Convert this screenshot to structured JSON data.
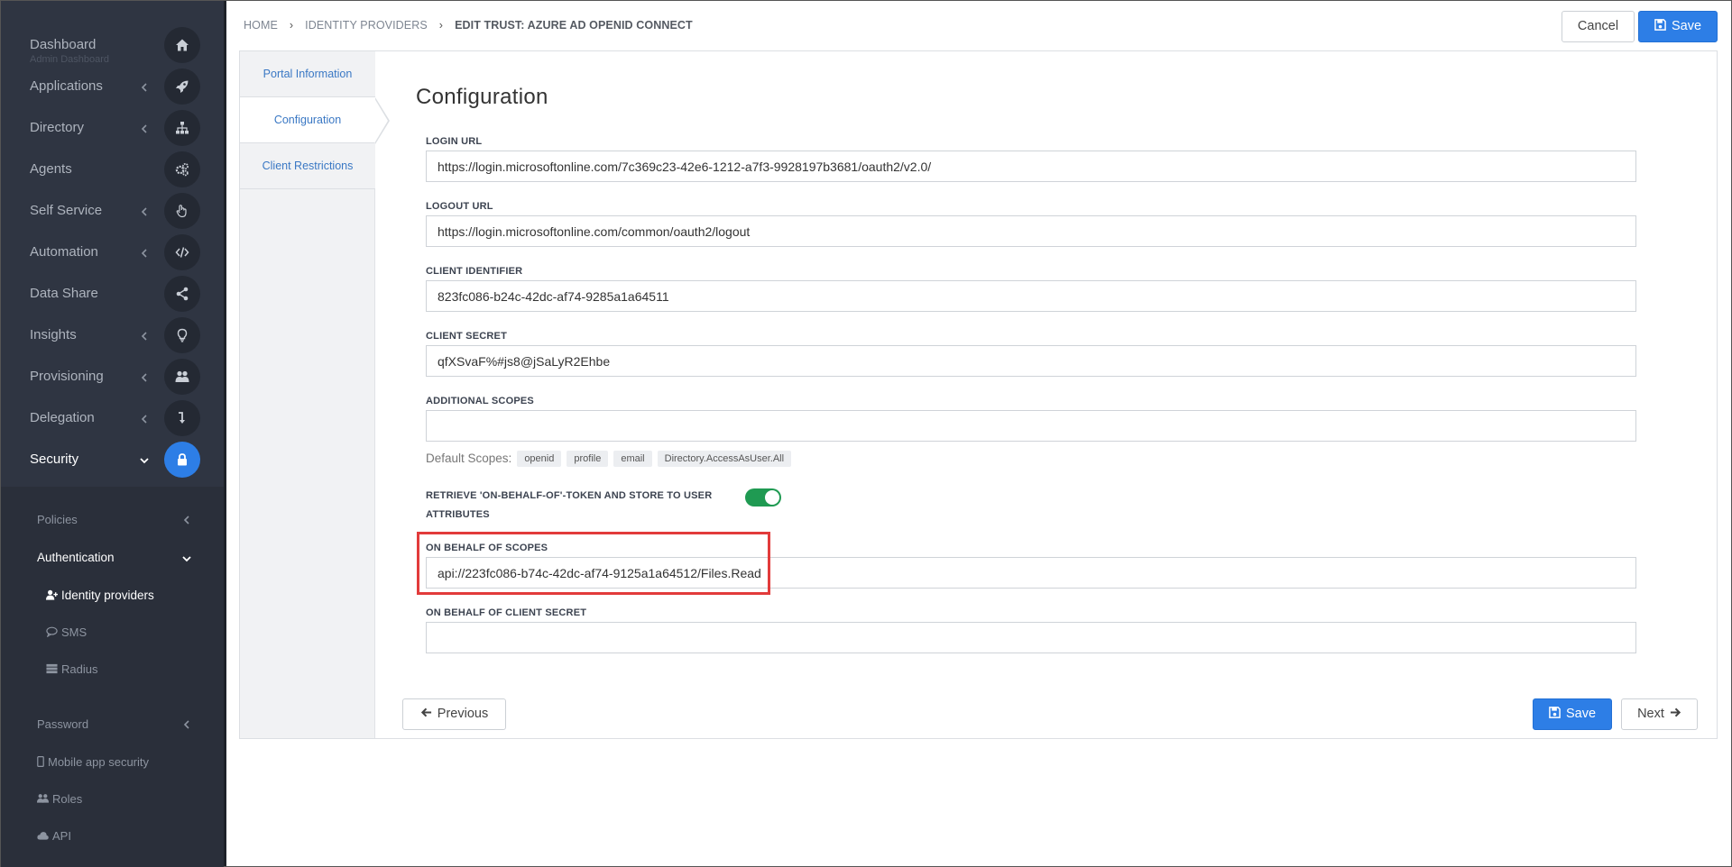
{
  "sidebar": {
    "items": [
      {
        "label": "Dashboard",
        "sub": "Admin Dashboard",
        "icon": "home-icon",
        "chevron": false,
        "active": false
      },
      {
        "label": "Applications",
        "icon": "rocket-icon",
        "chevron": true,
        "active": false
      },
      {
        "label": "Directory",
        "icon": "sitemap-icon",
        "chevron": true,
        "active": false
      },
      {
        "label": "Agents",
        "icon": "gears-icon",
        "chevron": false,
        "active": false
      },
      {
        "label": "Self Service",
        "icon": "hand-icon",
        "chevron": true,
        "active": false
      },
      {
        "label": "Automation",
        "icon": "code-icon",
        "chevron": true,
        "active": false
      },
      {
        "label": "Data Share",
        "icon": "share-icon",
        "chevron": false,
        "active": false
      },
      {
        "label": "Insights",
        "icon": "lightbulb-icon",
        "chevron": true,
        "active": false
      },
      {
        "label": "Provisioning",
        "icon": "users-icon",
        "chevron": true,
        "active": false
      },
      {
        "label": "Delegation",
        "icon": "level-down-icon",
        "chevron": true,
        "active": false
      },
      {
        "label": "Security",
        "icon": "lock-icon",
        "chevron": true,
        "active": true
      }
    ],
    "security_menu": {
      "policies": "Policies",
      "authentication": "Authentication",
      "identity_providers": "Identity providers",
      "sms": "SMS",
      "radius": "Radius",
      "password": "Password",
      "mobile_app_security": "Mobile app security",
      "roles": "Roles",
      "api": "API"
    }
  },
  "breadcrumb": {
    "home": "HOME",
    "identity_providers": "IDENTITY PROVIDERS",
    "current": "EDIT TRUST: AZURE AD OPENID CONNECT"
  },
  "toolbar": {
    "cancel_label": "Cancel",
    "save_label": "Save"
  },
  "tabs": [
    {
      "label": "Portal Information",
      "active": false
    },
    {
      "label": "Configuration",
      "active": true
    },
    {
      "label": "Client Restrictions",
      "active": false
    }
  ],
  "form": {
    "title": "Configuration",
    "login_url": {
      "label": "LOGIN URL",
      "value": "https://login.microsoftonline.com/7c369c23-42e6-1212-a7f3-9928197b3681/oauth2/v2.0/"
    },
    "logout_url": {
      "label": "LOGOUT URL",
      "value": "https://login.microsoftonline.com/common/oauth2/logout"
    },
    "client_identifier": {
      "label": "CLIENT IDENTIFIER",
      "value": "823fc086-b24c-42dc-af74-9285a1a64511"
    },
    "client_secret": {
      "label": "CLIENT SECRET",
      "value": "qfXSvaF%#js8@jSaLyR2Ehbe"
    },
    "additional_scopes": {
      "label": "ADDITIONAL SCOPES",
      "value": ""
    },
    "default_scopes": {
      "label": "Default Scopes:",
      "tags": [
        "openid",
        "profile",
        "email",
        "Directory.AccessAsUser.All"
      ]
    },
    "obo_toggle": {
      "label_line1": "RETRIEVE 'ON-BEHALF-OF'-TOKEN AND STORE TO USER",
      "label_line2": "ATTRIBUTES",
      "on": true
    },
    "obo_scopes": {
      "label": "ON BEHALF OF SCOPES",
      "value": "api://223fc086-b74c-42dc-af74-9125a1a64512/Files.Read"
    },
    "obo_client_secret": {
      "label": "ON BEHALF OF CLIENT SECRET",
      "value": ""
    }
  },
  "footer": {
    "previous_label": "Previous",
    "save_label": "Save",
    "next_label": "Next"
  },
  "colors": {
    "sidebar_bg": "#2f3542",
    "accent": "#2d7ee6",
    "toggle_on": "#1f9a52",
    "highlight": "#e23b3b"
  }
}
